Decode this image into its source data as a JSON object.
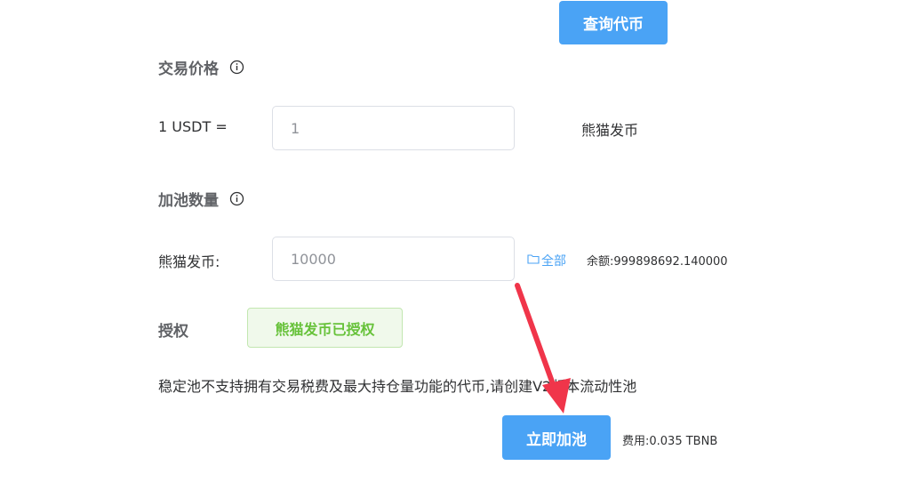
{
  "buttons": {
    "query_token": "查询代币",
    "add_liquidity": "立即加池"
  },
  "price_section": {
    "label": "交易价格",
    "base_label": "1 USDT =",
    "value": "1",
    "quote_token": "熊猫发币"
  },
  "amount_section": {
    "label": "加池数量",
    "token_label": "熊猫发币:",
    "value": "10000",
    "all_link": "全部",
    "balance": "余额:999898692.140000"
  },
  "authorize_section": {
    "label": "授权",
    "status": "熊猫发币已授权"
  },
  "notice": "稳定池不支持拥有交易税费及最大持仓量功能的代币,请创建V2版本流动性池",
  "fee": "费用:0.035 TBNB",
  "icons": {
    "info": "info-circle-icon",
    "folder": "folder-icon",
    "arrow": "red-arrow-annotation"
  },
  "colors": {
    "primary": "#4aa3f5",
    "success_text": "#67c23a",
    "success_bg": "#f0f9eb",
    "arrow": "#f0354a"
  }
}
